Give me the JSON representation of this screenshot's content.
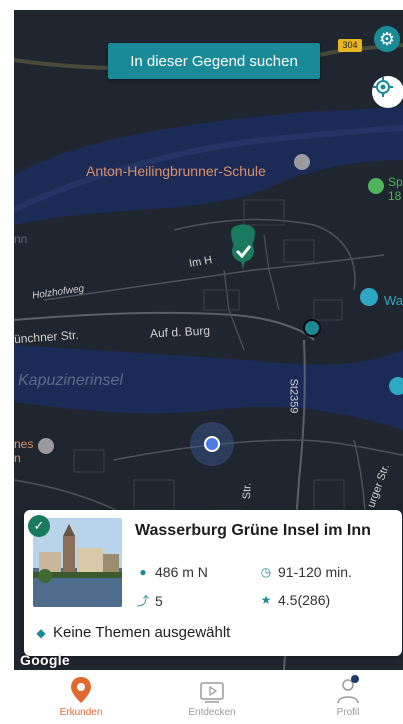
{
  "map": {
    "search_button": "In dieser Gegend suchen",
    "road_shield": "304",
    "labels": {
      "school": "Anton-Heilingbrunner-Schule",
      "im_h": "Im H",
      "holzhofweg": "Holzhofweg",
      "munchner": "ünchner Str.",
      "auf_d_burg": "Auf d. Burg",
      "kapuzinerinsel": "Kapuzinerinsel",
      "s2359": "St2359",
      "sp": "Sp\n18",
      "wa": "Wa",
      "ines": "nes\nn",
      "urger": "urger Str.",
      "str": "Str.",
      "inn": "nn"
    },
    "google": "Google"
  },
  "card": {
    "title": "Wasserburg Grüne Insel im Inn",
    "distance": "486 m N",
    "duration": "91-120 min.",
    "stops": "5",
    "rating": "4.5(286)",
    "themes": "Keine Themen ausgewählt"
  },
  "nav": {
    "explore": "Erkunden",
    "discover": "Entdecken",
    "profile": "Profil"
  },
  "colors": {
    "accent": "#1b8a98",
    "nav_active": "#e06a32",
    "map_bg": "#20262f",
    "water": "#1c2a56",
    "marker_green": "#1a7a5e"
  },
  "icons": {
    "settings": "gear-icon",
    "locate": "crosshair-icon",
    "distance": "location-pin-icon",
    "duration": "clock-icon",
    "stops": "route-icon",
    "rating": "star-icon",
    "themes": "tag-icon"
  }
}
